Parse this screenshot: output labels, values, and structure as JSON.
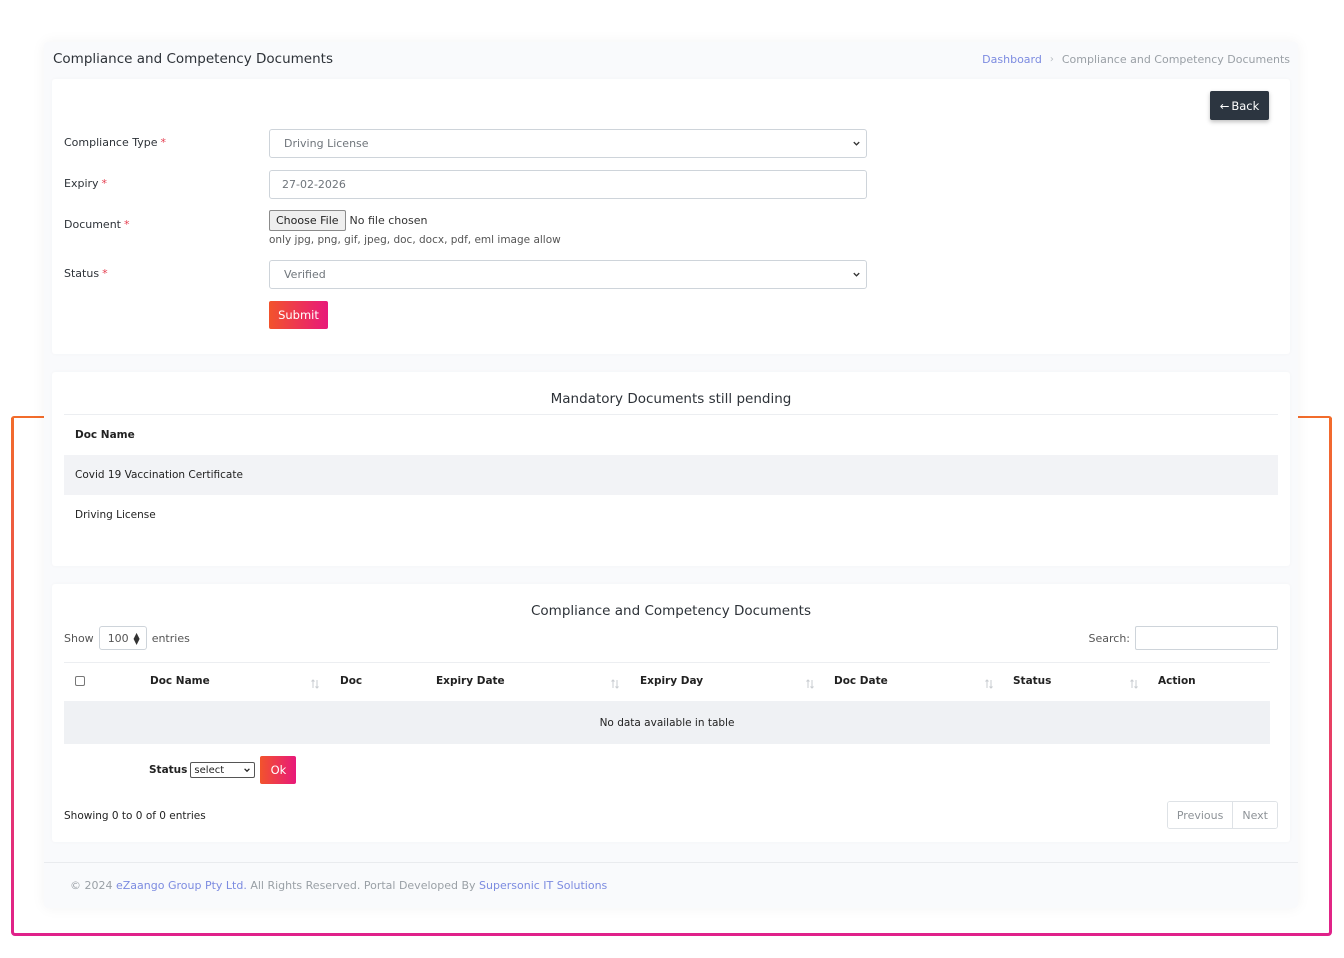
{
  "page": {
    "title": "Compliance and Competency Documents",
    "breadcrumb": {
      "home": "Dashboard",
      "separator": "›",
      "current": "Compliance and Competency Documents"
    }
  },
  "form": {
    "back_label": "Back",
    "compliance_type_label": "Compliance Type",
    "compliance_type_value": "Driving License",
    "expiry_label": "Expiry",
    "expiry_value": "27-02-2026",
    "document_label": "Document",
    "choose_file_label": "Choose File",
    "no_file_text": "No file chosen",
    "file_hint": "only jpg, png, gif, jpeg, doc, docx, pdf, eml image allow",
    "status_label": "Status",
    "status_value": "Verified",
    "required_mark": "*",
    "submit_label": "Submit"
  },
  "pending": {
    "title": "Mandatory Documents still pending",
    "column": "Doc Name",
    "rows": [
      "Covid 19 Vaccination Certificate",
      "Driving License"
    ]
  },
  "documents_table": {
    "title": "Compliance and Competency Documents",
    "show_label": "Show",
    "entries_label": "entries",
    "page_length": "100",
    "search_label": "Search:",
    "columns": [
      "Doc Name",
      "Doc",
      "Expiry Date",
      "Expiry Day",
      "Doc Date",
      "Status",
      "Action"
    ],
    "empty_text": "No data available in table",
    "bulk_status_label": "Status",
    "bulk_status_value": "select",
    "ok_label": "Ok",
    "info_text": "Showing 0 to 0 of 0 entries",
    "previous_label": "Previous",
    "next_label": "Next"
  },
  "footer": {
    "prefix": "© 2024 ",
    "company": "eZaango Group Pty Ltd.",
    "middle": " All Rights Reserved. Portal Developed By ",
    "developer": "Supersonic IT Solutions"
  },
  "colors": {
    "accent_start": "#f2532c",
    "accent_end": "#e8197a",
    "link": "#7c8be0",
    "dark_button": "#2c3540"
  }
}
